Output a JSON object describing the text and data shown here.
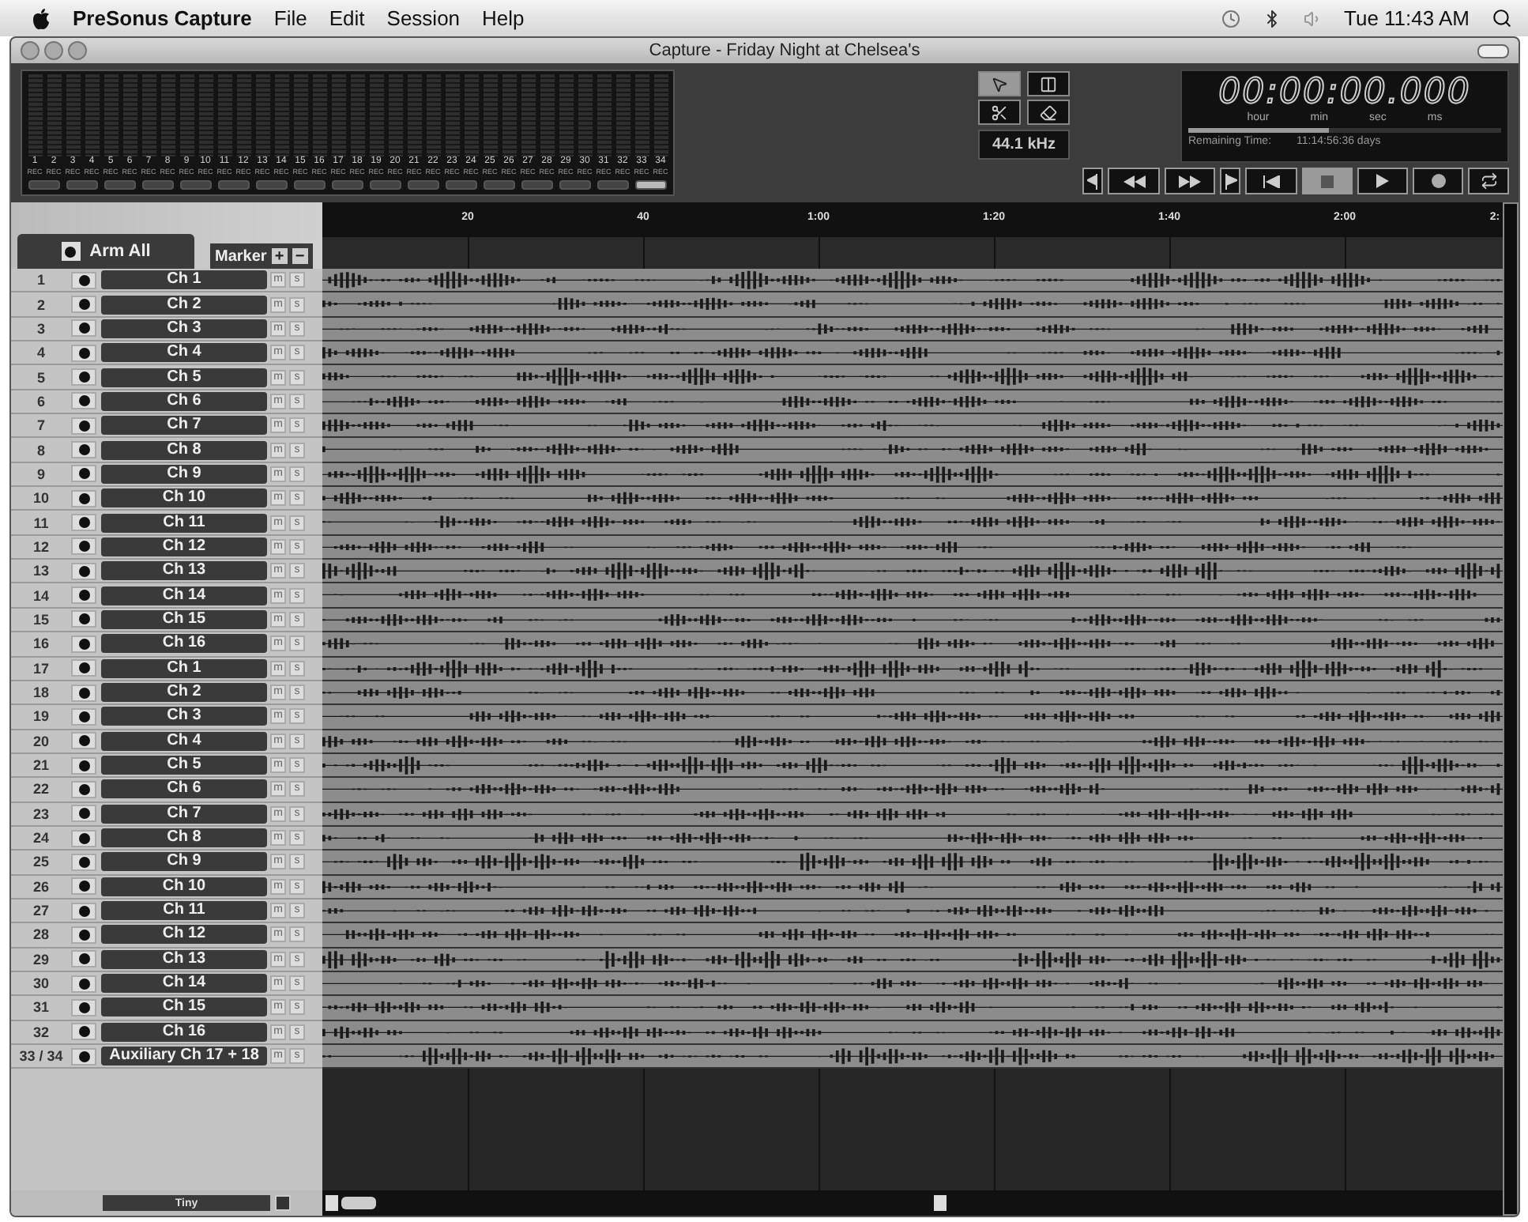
{
  "menu_bar": {
    "app": "PreSonus Capture",
    "menus": [
      "File",
      "Edit",
      "Session",
      "Help"
    ],
    "clock": "Tue 11:43 AM"
  },
  "window": {
    "title": "Capture - Friday Night at Chelsea's"
  },
  "meters": [
    {
      "number": "1",
      "label": "REC"
    },
    {
      "number": "2",
      "label": "REC"
    },
    {
      "number": "3",
      "label": "REC"
    },
    {
      "number": "4",
      "label": "REC"
    },
    {
      "number": "5",
      "label": "REC"
    },
    {
      "number": "6",
      "label": "REC"
    },
    {
      "number": "7",
      "label": "REC"
    },
    {
      "number": "8",
      "label": "REC"
    },
    {
      "number": "9",
      "label": "REC"
    },
    {
      "number": "10",
      "label": "REC"
    },
    {
      "number": "11",
      "label": "REC"
    },
    {
      "number": "12",
      "label": "REC"
    },
    {
      "number": "13",
      "label": "REC"
    },
    {
      "number": "14",
      "label": "REC"
    },
    {
      "number": "15",
      "label": "REC"
    },
    {
      "number": "16",
      "label": "REC"
    },
    {
      "number": "17",
      "label": "REC"
    },
    {
      "number": "18",
      "label": "REC"
    },
    {
      "number": "19",
      "label": "REC"
    },
    {
      "number": "20",
      "label": "REC"
    },
    {
      "number": "21",
      "label": "REC"
    },
    {
      "number": "22",
      "label": "REC"
    },
    {
      "number": "23",
      "label": "REC"
    },
    {
      "number": "24",
      "label": "REC"
    },
    {
      "number": "25",
      "label": "REC"
    },
    {
      "number": "26",
      "label": "REC"
    },
    {
      "number": "27",
      "label": "REC"
    },
    {
      "number": "28",
      "label": "REC"
    },
    {
      "number": "29",
      "label": "REC"
    },
    {
      "number": "30",
      "label": "REC"
    },
    {
      "number": "31",
      "label": "REC"
    },
    {
      "number": "32",
      "label": "REC"
    },
    {
      "number": "33",
      "label": "REC"
    },
    {
      "number": "34",
      "label": "REC"
    }
  ],
  "pair_buttons": [
    {
      "selected": false
    },
    {
      "selected": false
    },
    {
      "selected": false
    },
    {
      "selected": false
    },
    {
      "selected": false
    },
    {
      "selected": false
    },
    {
      "selected": false
    },
    {
      "selected": false
    },
    {
      "selected": false
    },
    {
      "selected": false
    },
    {
      "selected": false
    },
    {
      "selected": false
    },
    {
      "selected": false
    },
    {
      "selected": false
    },
    {
      "selected": false
    },
    {
      "selected": false
    },
    {
      "selected": true
    }
  ],
  "tools": [
    {
      "kind": "pointer",
      "selected": true
    },
    {
      "kind": "range",
      "selected": false
    },
    {
      "kind": "split",
      "selected": false
    },
    {
      "kind": "erase",
      "selected": false
    }
  ],
  "sample_rate": "44.1 kHz",
  "time_display": {
    "time": "00:00:00.000",
    "units": [
      "hour",
      "min",
      "sec",
      "ms"
    ],
    "level": 0.45,
    "remaining_label": "Remaining Time:",
    "remaining": "11:14:56:36 days"
  },
  "transport": [
    {
      "kind": "marker-back",
      "selected": false
    },
    {
      "kind": "rewind",
      "selected": false
    },
    {
      "kind": "forward",
      "selected": false
    },
    {
      "kind": "marker-forward",
      "selected": false
    },
    {
      "kind": "to-start",
      "selected": false
    },
    {
      "kind": "stop",
      "selected": true
    },
    {
      "kind": "play",
      "selected": false
    },
    {
      "kind": "record",
      "selected": false
    },
    {
      "kind": "loop",
      "selected": false
    }
  ],
  "track_header": {
    "arm_all": "Arm All",
    "marker": "Marker",
    "add": "+",
    "remove": "−"
  },
  "ruler": [
    "20",
    "40",
    "1:00",
    "1:20",
    "1:40",
    "2:00",
    "2:"
  ],
  "tracks": [
    {
      "number": "1",
      "name": "Ch 1",
      "mute": "m",
      "solo": "s"
    },
    {
      "number": "2",
      "name": "Ch 2",
      "mute": "m",
      "solo": "s"
    },
    {
      "number": "3",
      "name": "Ch 3",
      "mute": "m",
      "solo": "s"
    },
    {
      "number": "4",
      "name": "Ch 4",
      "mute": "m",
      "solo": "s"
    },
    {
      "number": "5",
      "name": "Ch 5",
      "mute": "m",
      "solo": "s"
    },
    {
      "number": "6",
      "name": "Ch 6",
      "mute": "m",
      "solo": "s"
    },
    {
      "number": "7",
      "name": "Ch 7",
      "mute": "m",
      "solo": "s"
    },
    {
      "number": "8",
      "name": "Ch 8",
      "mute": "m",
      "solo": "s"
    },
    {
      "number": "9",
      "name": "Ch 9",
      "mute": "m",
      "solo": "s"
    },
    {
      "number": "10",
      "name": "Ch 10",
      "mute": "m",
      "solo": "s"
    },
    {
      "number": "11",
      "name": "Ch 11",
      "mute": "m",
      "solo": "s"
    },
    {
      "number": "12",
      "name": "Ch 12",
      "mute": "m",
      "solo": "s"
    },
    {
      "number": "13",
      "name": "Ch 13",
      "mute": "m",
      "solo": "s"
    },
    {
      "number": "14",
      "name": "Ch 14",
      "mute": "m",
      "solo": "s"
    },
    {
      "number": "15",
      "name": "Ch 15",
      "mute": "m",
      "solo": "s"
    },
    {
      "number": "16",
      "name": "Ch 16",
      "mute": "m",
      "solo": "s"
    },
    {
      "number": "17",
      "name": "Ch 1",
      "mute": "m",
      "solo": "s"
    },
    {
      "number": "18",
      "name": "Ch 2",
      "mute": "m",
      "solo": "s"
    },
    {
      "number": "19",
      "name": "Ch 3",
      "mute": "m",
      "solo": "s"
    },
    {
      "number": "20",
      "name": "Ch 4",
      "mute": "m",
      "solo": "s"
    },
    {
      "number": "21",
      "name": "Ch 5",
      "mute": "m",
      "solo": "s"
    },
    {
      "number": "22",
      "name": "Ch 6",
      "mute": "m",
      "solo": "s"
    },
    {
      "number": "23",
      "name": "Ch 7",
      "mute": "m",
      "solo": "s"
    },
    {
      "number": "24",
      "name": "Ch 8",
      "mute": "m",
      "solo": "s"
    },
    {
      "number": "25",
      "name": "Ch 9",
      "mute": "m",
      "solo": "s"
    },
    {
      "number": "26",
      "name": "Ch 10",
      "mute": "m",
      "solo": "s"
    },
    {
      "number": "27",
      "name": "Ch 11",
      "mute": "m",
      "solo": "s"
    },
    {
      "number": "28",
      "name": "Ch 12",
      "mute": "m",
      "solo": "s"
    },
    {
      "number": "29",
      "name": "Ch 13",
      "mute": "m",
      "solo": "s"
    },
    {
      "number": "30",
      "name": "Ch 14",
      "mute": "m",
      "solo": "s"
    },
    {
      "number": "31",
      "name": "Ch 15",
      "mute": "m",
      "solo": "s"
    },
    {
      "number": "32",
      "name": "Ch 16",
      "mute": "m",
      "solo": "s"
    },
    {
      "number": "33 / 34",
      "name": "Auxiliary Ch 17 + 18",
      "mute": "m",
      "solo": "s"
    }
  ],
  "track_size": "Tiny"
}
